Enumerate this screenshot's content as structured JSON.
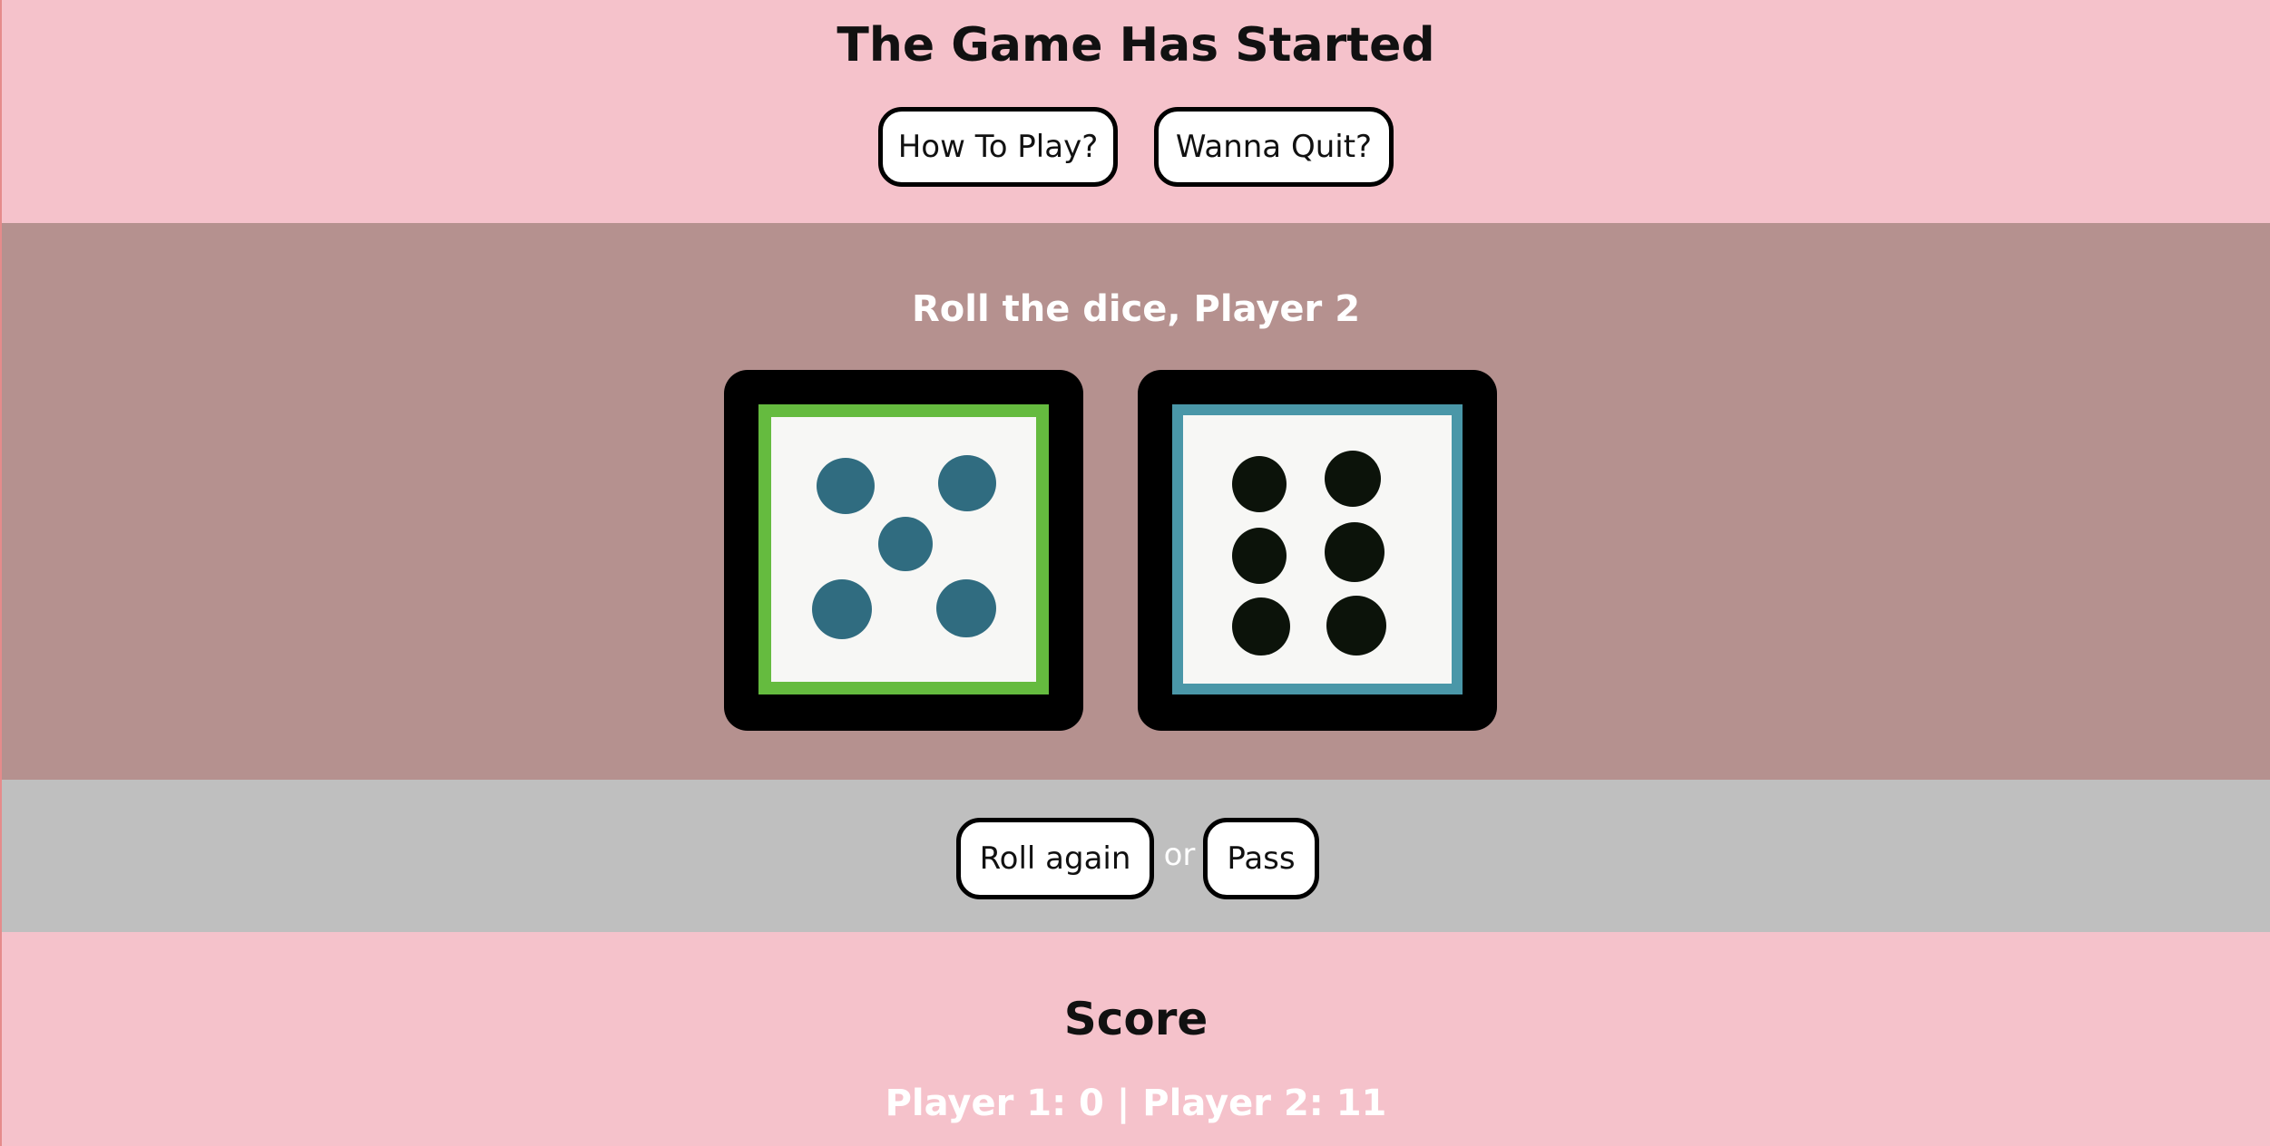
{
  "header": {
    "title": "The Game Has Started",
    "how_to_play_label": "How To Play?",
    "quit_label": "Wanna Quit?"
  },
  "dice_area": {
    "prompt": "Roll the dice, Player 2",
    "dice": [
      {
        "value": 5,
        "border_color": "#65bb3f",
        "pip_color": "#306c80"
      },
      {
        "value": 6,
        "border_color": "#4a97a8",
        "pip_color": "#0c130a"
      }
    ]
  },
  "actions": {
    "roll_again_label": "Roll again",
    "or_text": "or",
    "pass_label": "Pass"
  },
  "score": {
    "title": "Score",
    "line": "Player 1: 0 | Player 2: 11",
    "player1": 0,
    "player2": 11
  },
  "colors": {
    "page_background": "#f5c2cb",
    "dice_area_background": "#b5918f",
    "action_bar_background": "#bfbfbf"
  }
}
